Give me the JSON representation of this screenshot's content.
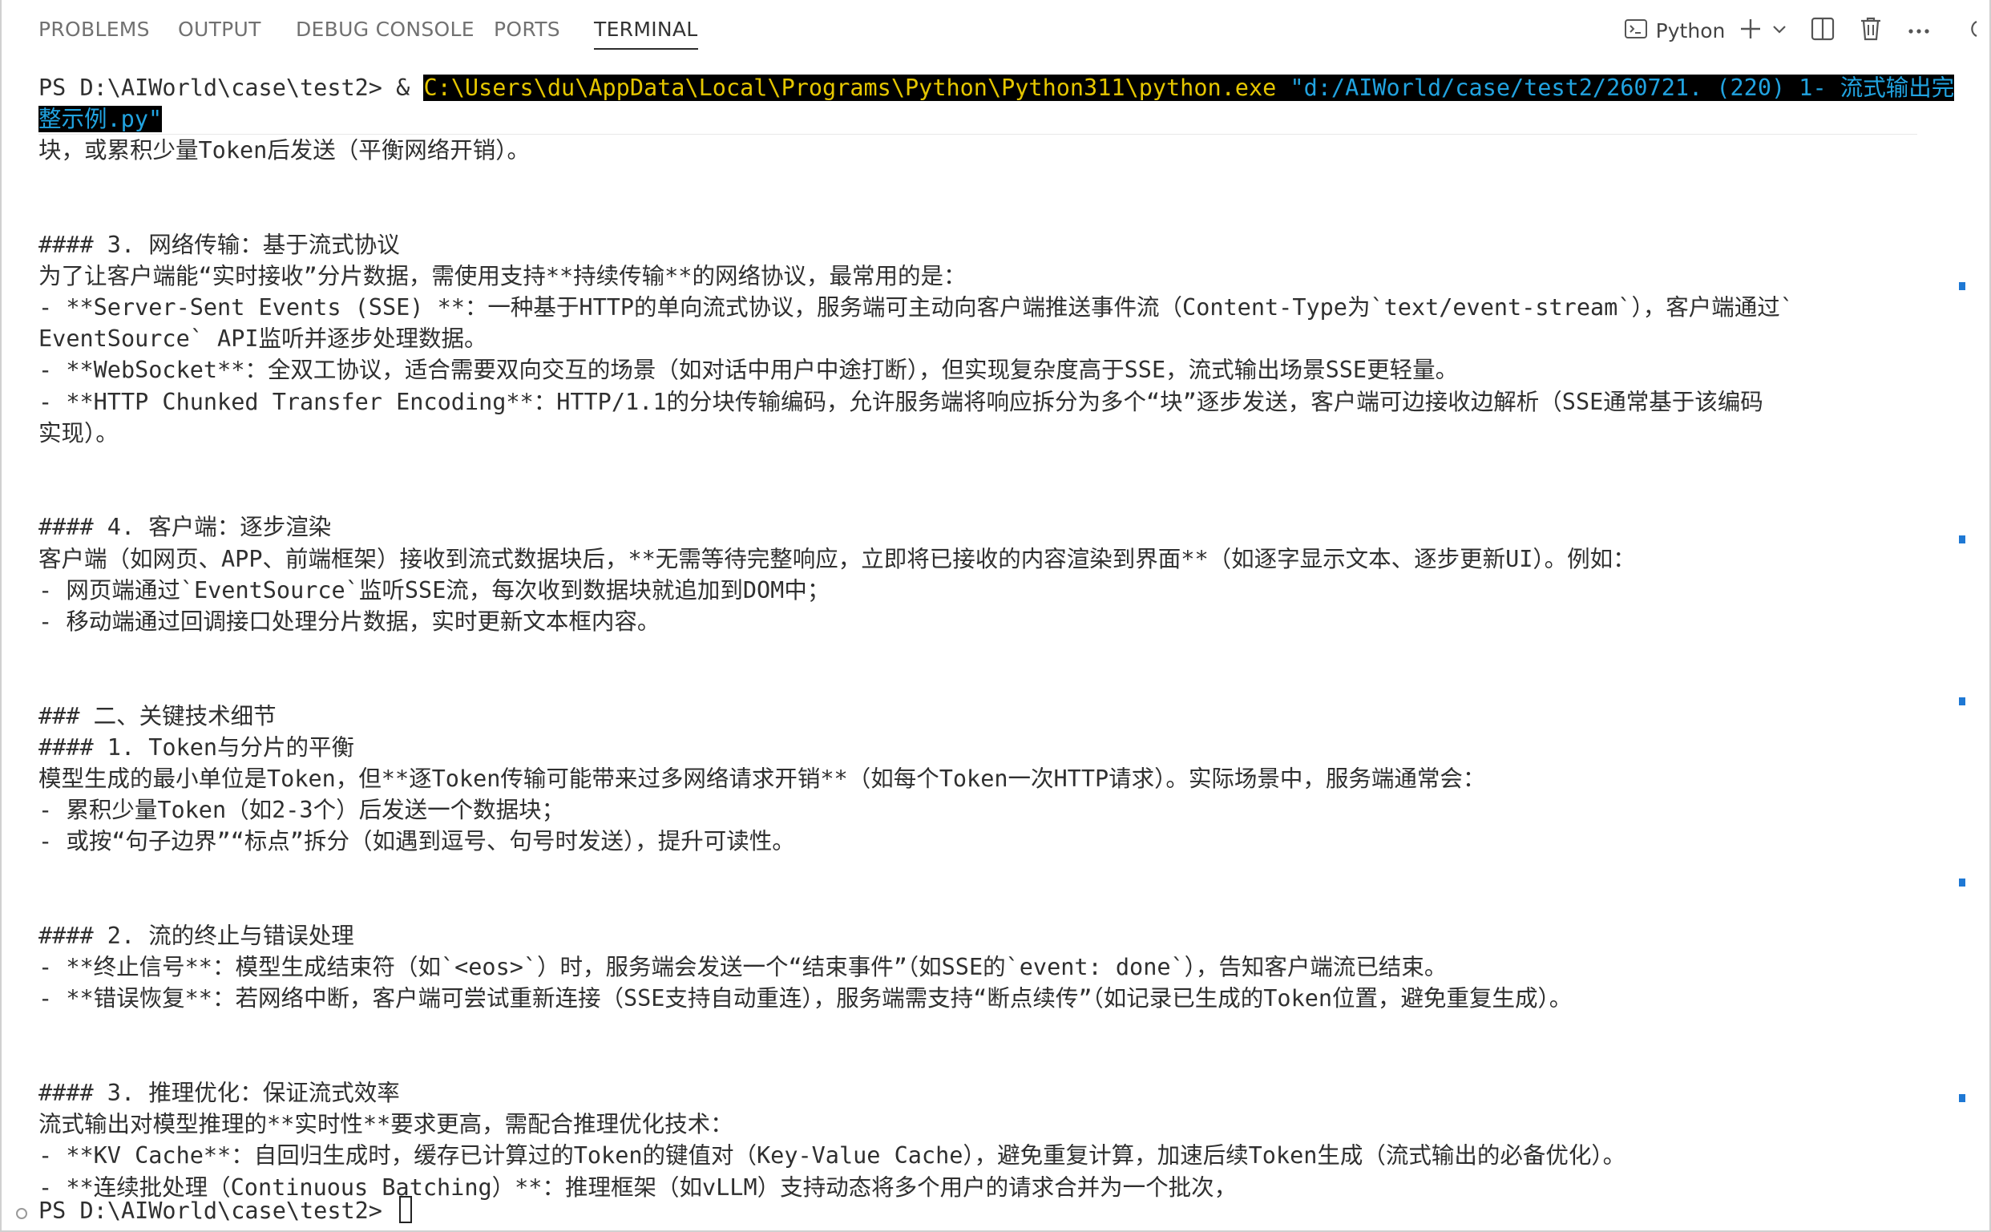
{
  "tabs": {
    "problems": "PROBLEMS",
    "output": "OUTPUT",
    "debug_console": "DEBUG CONSOLE",
    "ports": "PORTS",
    "terminal": "TERMINAL"
  },
  "toolbar": {
    "shell_label": "Python"
  },
  "terminal": {
    "command": {
      "prompt": "PS D:\\AIWorld\\case\\test2> ",
      "ampersand": "& ",
      "exe": "C:\\Users\\du\\AppData\\Local\\Programs\\Python\\Python311\\python.exe ",
      "script_part1": "\"d:/AIWorld/case/test2/260721. (220) 1- 流式输出完",
      "script_part2": "整示例.py\""
    },
    "lines": [
      "块，或累积少量Token后发送（平衡网络开销）。",
      "",
      "",
      "#### 3. 网络传输：基于流式协议",
      "为了让客户端能“实时接收”分片数据，需使用支持**持续传输**的网络协议，最常用的是：",
      "- **Server-Sent Events (SSE) **：一种基于HTTP的单向流式协议，服务端可主动向客户端推送事件流（Content-Type为`text/event-stream`），客户端通过`",
      "EventSource` API监听并逐步处理数据。",
      "- **WebSocket**：全双工协议，适合需要双向交互的场景（如对话中用户中途打断），但实现复杂度高于SSE，流式输出场景SSE更轻量。",
      "- **HTTP Chunked Transfer Encoding**：HTTP/1.1的分块传输编码，允许服务端将响应拆分为多个“块”逐步发送，客户端可边接收边解析（SSE通常基于该编码",
      "实现）。",
      "",
      "",
      "#### 4. 客户端：逐步渲染",
      "客户端（如网页、APP、前端框架）接收到流式数据块后，**无需等待完整响应，立即将已接收的内容渲染到界面**（如逐字显示文本、逐步更新UI）。例如：",
      "- 网页端通过`EventSource`监听SSE流，每次收到数据块就追加到DOM中；",
      "- 移动端通过回调接口处理分片数据，实时更新文本框内容。",
      "",
      "",
      "### 二、关键技术细节",
      "#### 1. Token与分片的平衡",
      "模型生成的最小单位是Token，但**逐Token传输可能带来过多网络请求开销**（如每个Token一次HTTP请求）。实际场景中，服务端通常会：",
      "- 累积少量Token（如2-3个）后发送一个数据块；",
      "- 或按“句子边界”“标点”拆分（如遇到逗号、句号时发送），提升可读性。",
      "",
      "",
      "#### 2. 流的终止与错误处理",
      "- **终止信号**：模型生成结束符（如`<eos>`）时，服务端会发送一个“结束事件”（如SSE的`event: done`），告知客户端流已结束。",
      "- **错误恢复**：若网络中断，客户端可尝试重新连接（SSE支持自动重连），服务端需支持“断点续传”（如记录已生成的Token位置，避免重复生成）。",
      "",
      "",
      "#### 3. 推理优化：保证流式效率",
      "流式输出对模型推理的**实时性**要求更高，需配合推理优化技术：",
      "- **KV Cache**：自回归生成时，缓存已计算过的Token的键值对（Key-Value Cache），避免重复计算，加速后续Token生成（流式输出的必备优化）。",
      "- **连续批处理（Continuous Batching）**：推理框架（如vLLM）支持动态将多个用户的请求合并为一个批次，"
    ],
    "final_prompt": "PS D:\\AIWorld\\case\\test2> "
  },
  "colors": {
    "highlight_bg": "#000000",
    "exe_text": "#e5c600",
    "string_text": "#21a3e0",
    "scroll_marker": "#1e78d4"
  }
}
